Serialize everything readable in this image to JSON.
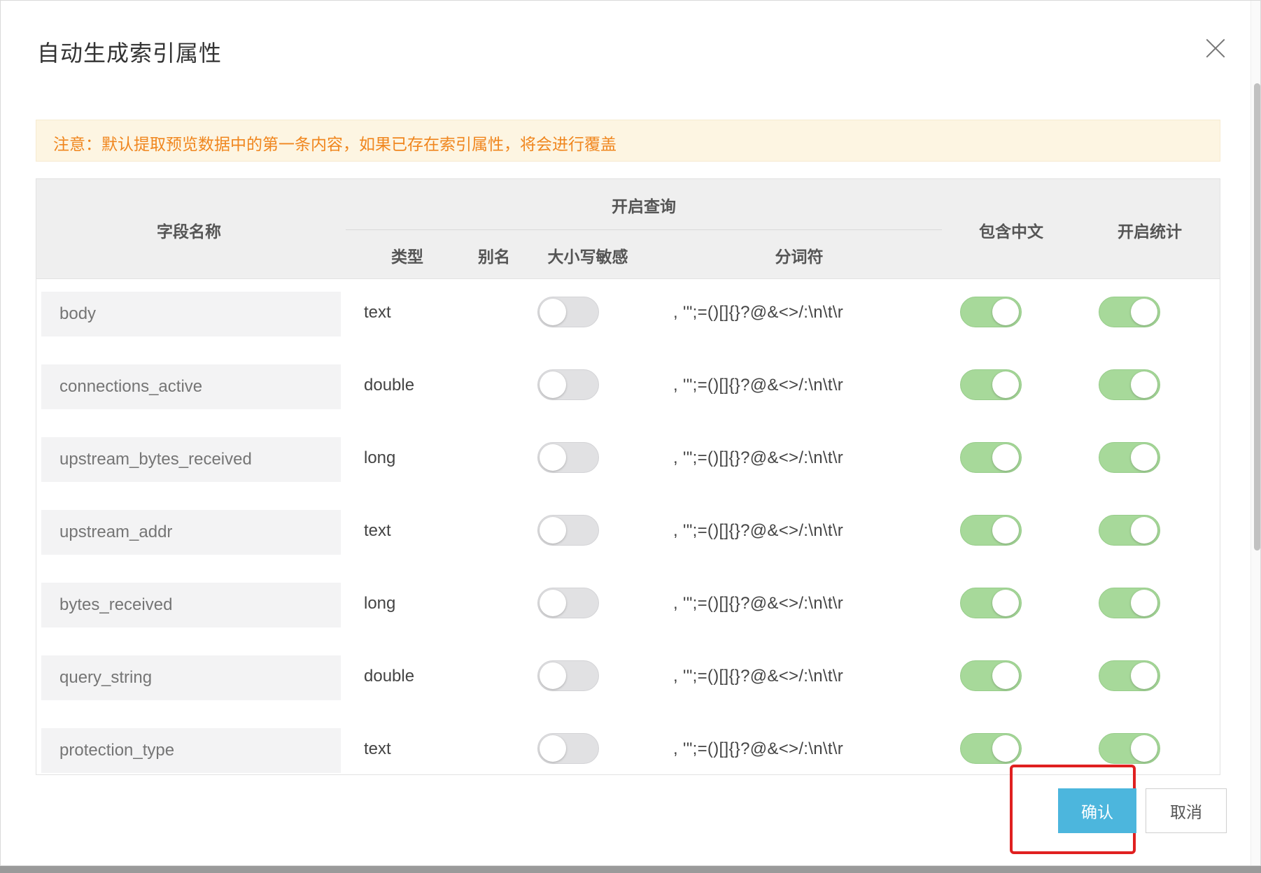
{
  "dialog": {
    "title": "自动生成索引属性",
    "notice": "注意：默认提取预览数据中的第一条内容，如果已存在索引属性，将会进行覆盖",
    "confirm_label": "确认",
    "cancel_label": "取消"
  },
  "table": {
    "headers": {
      "field_name": "字段名称",
      "enable_query": "开启查询",
      "type": "类型",
      "alias": "别名",
      "case_sensitive": "大小写敏感",
      "tokenizer": "分词符",
      "include_chinese": "包含中文",
      "enable_stats": "开启统计"
    },
    "rows": [
      {
        "name": "body",
        "type": "text",
        "alias": "",
        "case_sensitive": false,
        "tokenizer": ", '\";=()[]{}?@&<>/:\\n\\t\\r",
        "include_chinese": true,
        "enable_stats": true
      },
      {
        "name": "connections_active",
        "type": "double",
        "alias": "",
        "case_sensitive": false,
        "tokenizer": ", '\";=()[]{}?@&<>/:\\n\\t\\r",
        "include_chinese": true,
        "enable_stats": true
      },
      {
        "name": "upstream_bytes_received",
        "type": "long",
        "alias": "",
        "case_sensitive": false,
        "tokenizer": ", '\";=()[]{}?@&<>/:\\n\\t\\r",
        "include_chinese": true,
        "enable_stats": true
      },
      {
        "name": "upstream_addr",
        "type": "text",
        "alias": "",
        "case_sensitive": false,
        "tokenizer": ", '\";=()[]{}?@&<>/:\\n\\t\\r",
        "include_chinese": true,
        "enable_stats": true
      },
      {
        "name": "bytes_received",
        "type": "long",
        "alias": "",
        "case_sensitive": false,
        "tokenizer": ", '\";=()[]{}?@&<>/:\\n\\t\\r",
        "include_chinese": true,
        "enable_stats": true
      },
      {
        "name": "query_string",
        "type": "double",
        "alias": "",
        "case_sensitive": false,
        "tokenizer": ", '\";=()[]{}?@&<>/:\\n\\t\\r",
        "include_chinese": true,
        "enable_stats": true
      },
      {
        "name": "protection_type",
        "type": "text",
        "alias": "",
        "case_sensitive": false,
        "tokenizer": ", '\";=()[]{}?@&<>/:\\n\\t\\r",
        "include_chinese": true,
        "enable_stats": true
      }
    ]
  },
  "colors": {
    "toggle_on": "#a7d99a",
    "toggle_off": "#e1e1e3",
    "confirm_button": "#4cb6dd",
    "notice_text": "#f0861e",
    "highlight": "#e02020"
  }
}
